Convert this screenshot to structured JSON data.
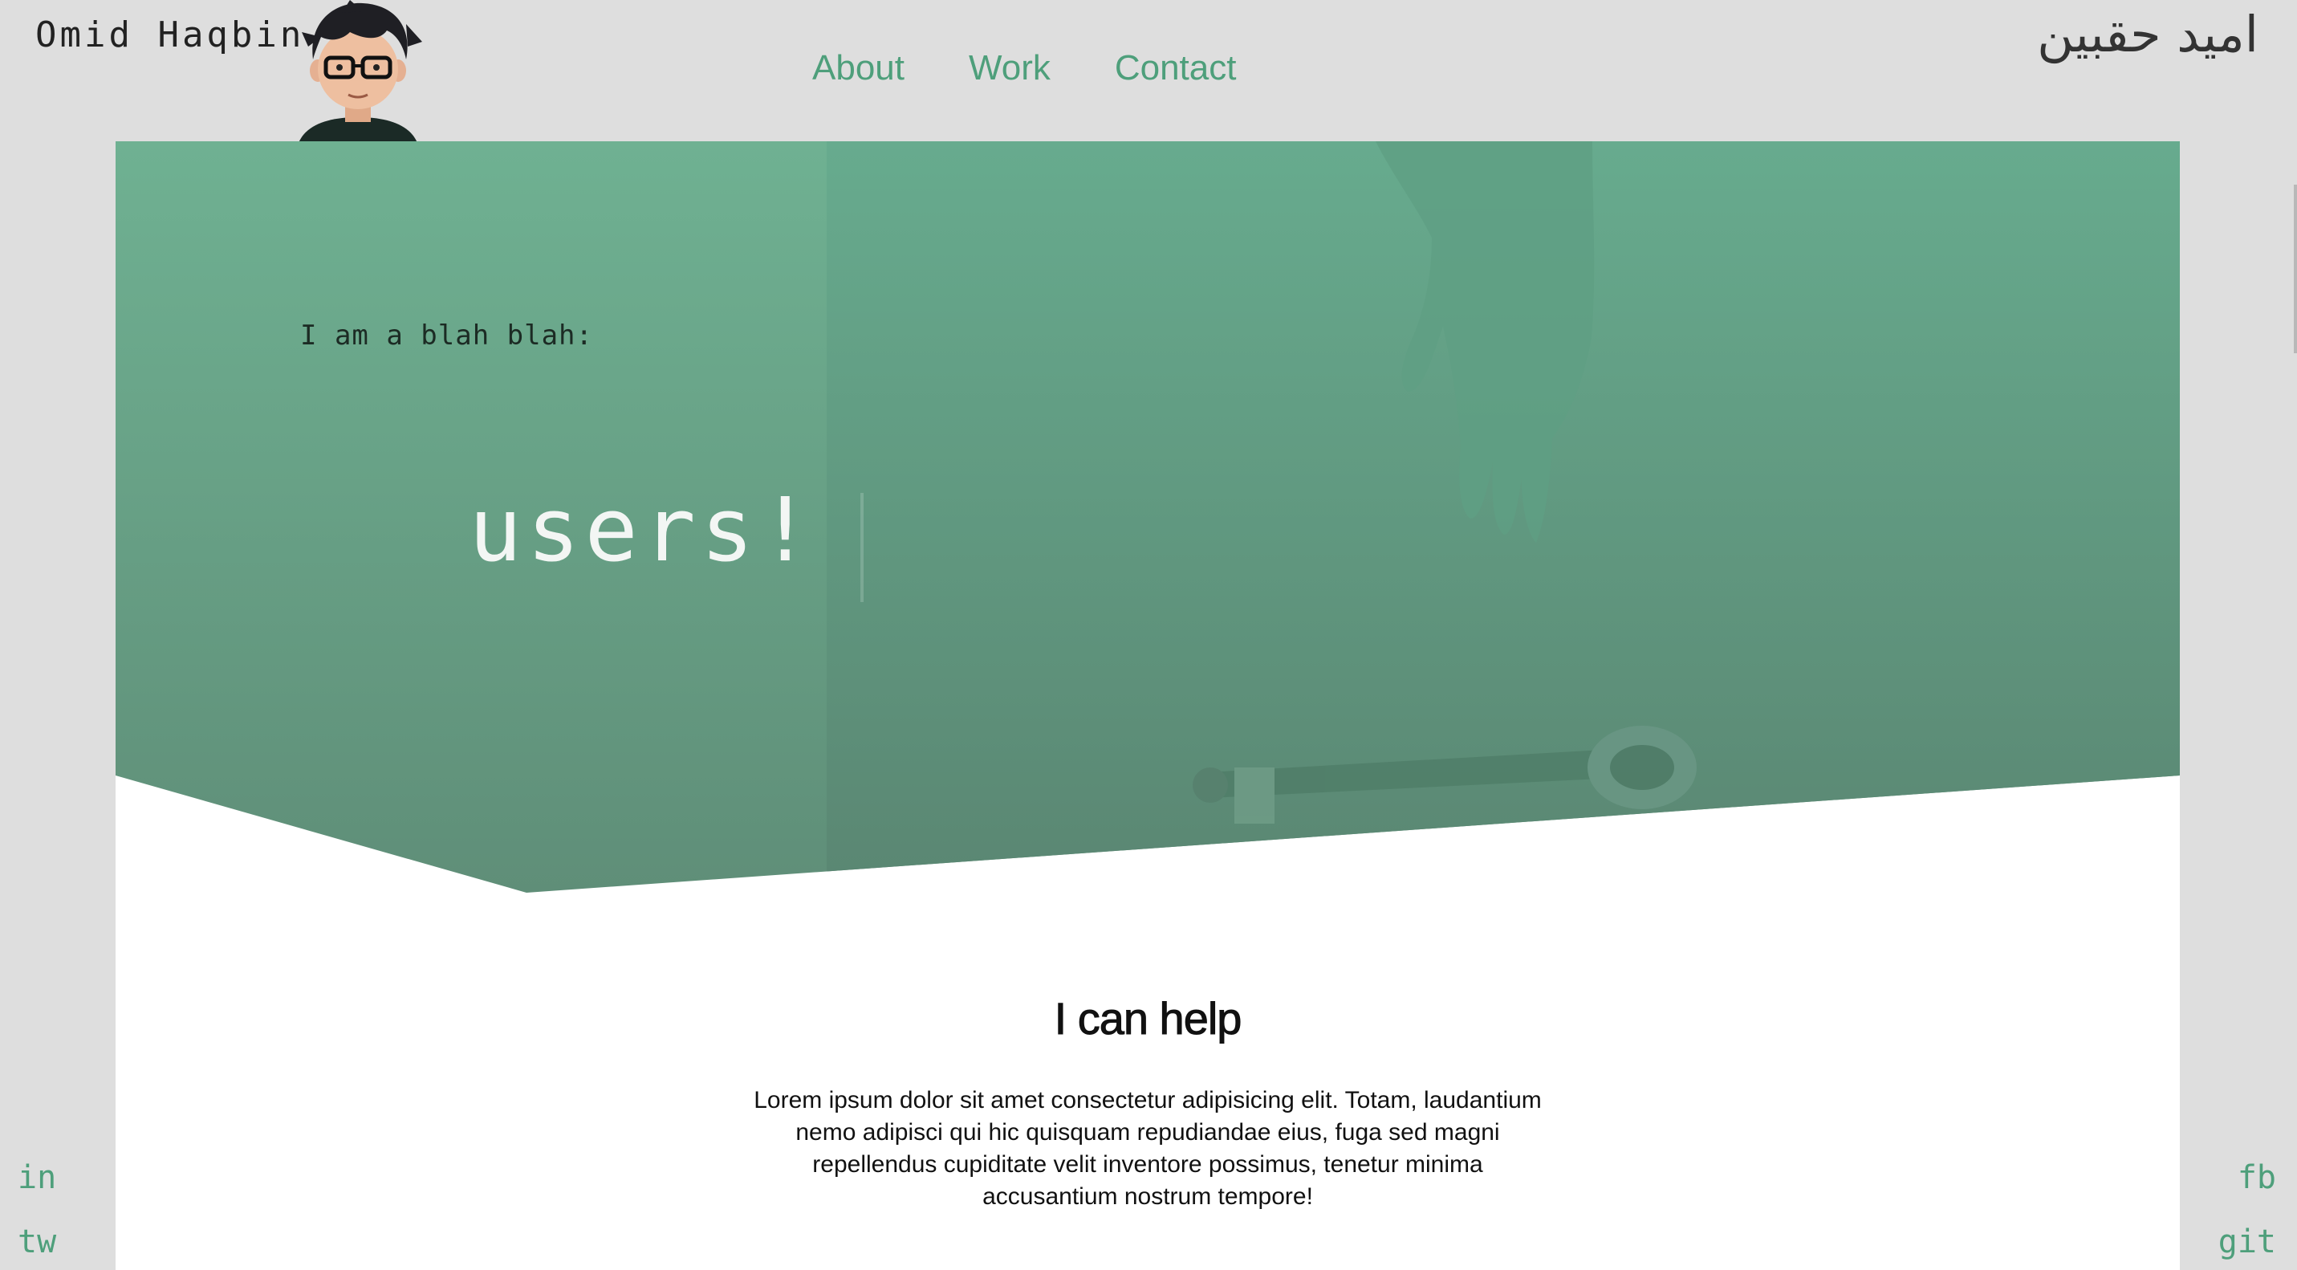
{
  "header": {
    "name": "Omid Haqbin",
    "name_arabic": "امید حقبین",
    "nav": [
      {
        "label": "About"
      },
      {
        "label": "Work"
      },
      {
        "label": "Contact"
      }
    ]
  },
  "hero": {
    "intro": "I am a blah blah:",
    "typed_word": "users!"
  },
  "help": {
    "heading": "I can help",
    "body": "Lorem ipsum dolor sit amet consectetur adipisicing elit. Totam, laudantium nemo adipisci qui hic quisquam repudiandae eius, fuga sed magni repellendus cupiditate velit inventore possimus, tenetur minima accusantium nostrum tempore!"
  },
  "social": {
    "linkedin": "in",
    "twitter": "tw",
    "facebook": "fb",
    "github": "git"
  },
  "colors": {
    "accent": "#4e9f7b",
    "hero_overlay": "#6aae91",
    "page_bg": "#dedede"
  }
}
